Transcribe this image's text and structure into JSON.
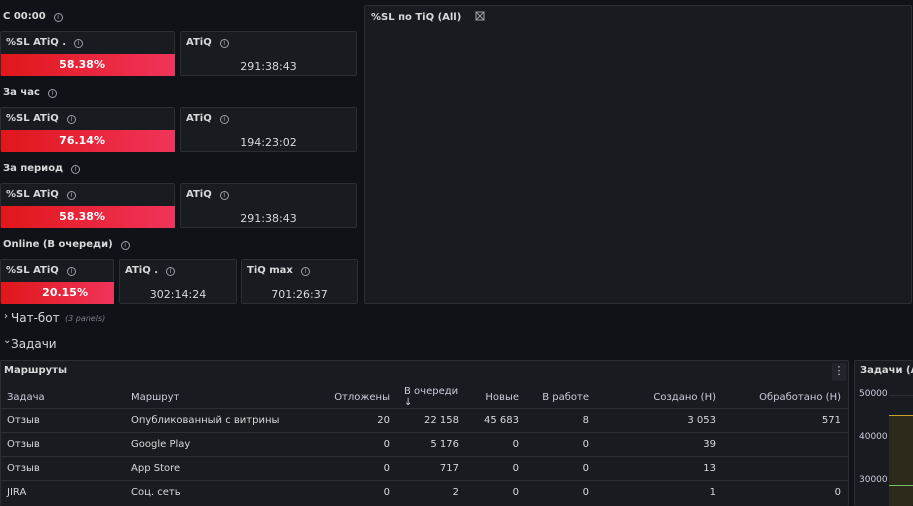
{
  "groups": {
    "since_midnight": "С 00:00",
    "per_hour": "За час",
    "per_period": "За период",
    "online": "Online (В очереди)"
  },
  "stats": {
    "s1_sl_title": "%SL ATiQ .",
    "s1_sl_value": "58.38%",
    "s1_atiq_title": "ATiQ",
    "s1_atiq_value": "291:38:43",
    "s2_sl_title": "%SL ATiQ",
    "s2_sl_value": "76.14%",
    "s2_atiq_title": "ATiQ",
    "s2_atiq_value": "194:23:02",
    "s3_sl_title": "%SL ATiQ",
    "s3_sl_value": "58.38%",
    "s3_atiq_title": "ATiQ",
    "s3_atiq_value": "291:38:43",
    "s4_sl_title": "%SL ATiQ",
    "s4_sl_value": "20.15%",
    "s4_atiq_title": "ATiQ .",
    "s4_atiq_value": "302:14:24",
    "s4_tiq_title": "TiQ max",
    "s4_tiq_value": "701:26:37"
  },
  "sl_panel": {
    "title": "%SL по TiQ (All)"
  },
  "rows": {
    "chatbot": "Чат-бот",
    "chatbot_meta": "(3 panels)",
    "tasks": "Задачи"
  },
  "routes": {
    "title": "Маршруты",
    "columns": [
      "Задача",
      "Маршрут",
      "Отложены",
      "В очереди",
      "Новые",
      "В работе",
      "Создано (Н)",
      "Обработано (Н)"
    ],
    "sort_indicator": "↓",
    "rows": [
      [
        "Отзыв",
        "Опубликованный с витрины",
        "20",
        "22 158",
        "45 683",
        "8",
        "3 053",
        "571"
      ],
      [
        "Отзыв",
        "Google Play",
        "0",
        "5 176",
        "0",
        "0",
        "39",
        ""
      ],
      [
        "Отзыв",
        "App Store",
        "0",
        "717",
        "0",
        "0",
        "13",
        ""
      ],
      [
        "JIRA",
        "Соц. сеть",
        "0",
        "2",
        "0",
        "0",
        "1",
        "0"
      ]
    ]
  },
  "tasks_chart": {
    "title": "Задачи (All)",
    "ticks": [
      "50000",
      "40000",
      "30000"
    ]
  },
  "colors": {
    "bar_start": "#e0161a",
    "bar_end": "#f0345a",
    "bg": "#111217",
    "panel": "#181b1f"
  }
}
